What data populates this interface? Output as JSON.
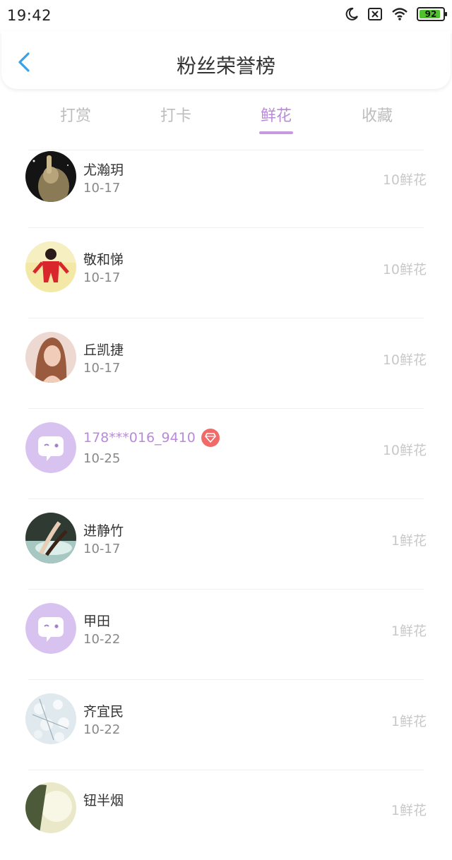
{
  "status_bar": {
    "time": "19:42",
    "battery_level": "92",
    "battery_percent": 92,
    "icons": [
      "moon-icon",
      "no-sim-icon",
      "wifi-icon",
      "battery-icon"
    ]
  },
  "header": {
    "title": "粉丝荣誉榜",
    "back_icon": "chevron-left-icon"
  },
  "tabs": [
    {
      "label": "打赏",
      "active": false
    },
    {
      "label": "打卡",
      "active": false
    },
    {
      "label": "鲜花",
      "active": true
    },
    {
      "label": "收藏",
      "active": false
    }
  ],
  "colors": {
    "accent": "#b98ad8",
    "back_icon": "#3aa0e8",
    "badge": "#f06a6a",
    "battery": "#4fc22b"
  },
  "fans": [
    {
      "name": "尤瀚玥",
      "date": "10-17",
      "count": "10鲜花",
      "avatar": "photo-avatar"
    },
    {
      "name": "敬和悌",
      "date": "10-17",
      "count": "10鲜花",
      "avatar": "photo-avatar"
    },
    {
      "name": "丘凯捷",
      "date": "10-17",
      "count": "10鲜花",
      "avatar": "photo-avatar"
    },
    {
      "name": "178***016_9410",
      "date": "10-25",
      "count": "10鲜花",
      "avatar": "default-chat-avatar",
      "vip": true
    },
    {
      "name": "进静竹",
      "date": "10-17",
      "count": "1鲜花",
      "avatar": "photo-avatar"
    },
    {
      "name": "甲田",
      "date": "10-22",
      "count": "1鲜花",
      "avatar": "default-chat-avatar"
    },
    {
      "name": "齐宜民",
      "date": "10-22",
      "count": "1鲜花",
      "avatar": "photo-avatar"
    },
    {
      "name": "钮半烟",
      "date": "",
      "count": "1鲜花",
      "avatar": "photo-avatar"
    }
  ]
}
